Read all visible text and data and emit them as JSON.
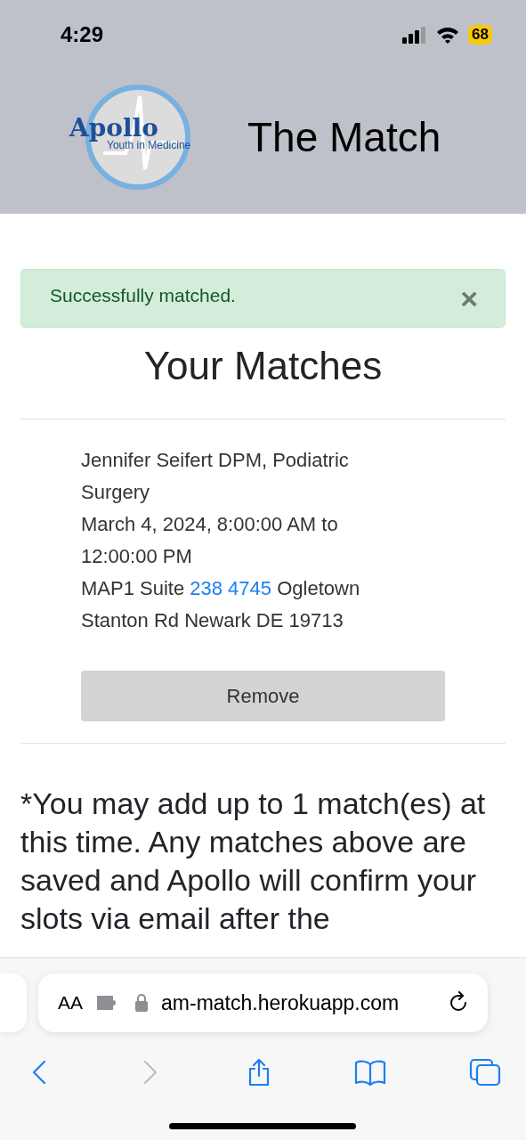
{
  "status_bar": {
    "time": "4:29",
    "battery": "68"
  },
  "header": {
    "logo_title": "Apollo",
    "logo_subtitle": "Youth in Medicine",
    "title": "The Match"
  },
  "alert": {
    "message": "Successfully matched.",
    "close": "×"
  },
  "heading": "Your Matches",
  "matches": [
    {
      "doctor": "Jennifer Seifert DPM, Podiatric Surgery",
      "time": "March 4, 2024, 8:00:00 AM to 12:00:00 PM",
      "address_before": "MAP1 Suite",
      "address_link": "238 4745",
      "address_after": "Ogletown Stanton Rd Newark DE 19713",
      "button": "Remove"
    }
  ],
  "note": "*You may add up to 1 match(es) at this time. Any matches above are saved and Apollo will confirm your slots via email after the",
  "browser": {
    "text_size": "AA",
    "url": "am-match.herokuapp.com",
    "nav": [
      {
        "kind": "back",
        "disabled": false
      },
      {
        "kind": "forward",
        "disabled": true
      },
      {
        "kind": "share",
        "disabled": false
      },
      {
        "kind": "bookmarks",
        "disabled": false
      },
      {
        "kind": "tabs",
        "disabled": false
      }
    ]
  }
}
